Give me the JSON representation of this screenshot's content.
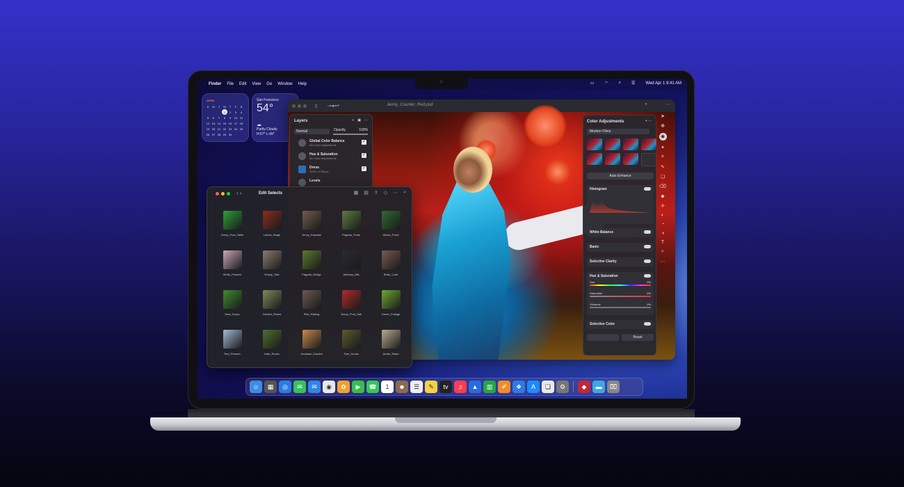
{
  "menubar": {
    "apple": "",
    "app": "Finder",
    "items": [
      "File",
      "Edit",
      "View",
      "Go",
      "Window",
      "Help"
    ],
    "datetime": "Wed Apr 1  9:41 AM"
  },
  "calendar": {
    "month": "APRIL",
    "weekdays": [
      "S",
      "M",
      "T",
      "W",
      "T",
      "F",
      "S"
    ],
    "weeks": [
      [
        "",
        "",
        "",
        "1",
        "2",
        "3",
        "4"
      ],
      [
        "5",
        "6",
        "7",
        "8",
        "9",
        "10",
        "11"
      ],
      [
        "12",
        "13",
        "14",
        "15",
        "16",
        "17",
        "18"
      ],
      [
        "19",
        "20",
        "21",
        "22",
        "23",
        "24",
        "25"
      ],
      [
        "26",
        "27",
        "28",
        "29",
        "30",
        "",
        ""
      ]
    ],
    "today": "1"
  },
  "weather": {
    "city": "San Francisco",
    "temp": "54°",
    "condition": "Partly Cloudy",
    "hilo": "H:57° L:49°"
  },
  "photo_app": {
    "filename": "Jenny_Counter_Red.psd"
  },
  "layers": {
    "title": "Layers",
    "blend_mode": "Normal",
    "opacity_label": "Opacity",
    "opacity_value": "100%",
    "items": [
      {
        "name": "Global Color Balance",
        "sub": "No Color Adjustments"
      },
      {
        "name": "Hue & Saturation",
        "sub": "No Color Adjustments"
      },
      {
        "name": "Dress",
        "sub": "1203 x 1755 px"
      },
      {
        "name": "Levels",
        "sub": ""
      }
    ]
  },
  "color_adjustments": {
    "title": "Color Adjustments",
    "preset": "Modern Films",
    "auto": "Auto Enhance",
    "histogram": "Histogram",
    "white_balance": "White Balance",
    "basic": "Basic",
    "selective_clarity": "Selective Clarity",
    "hue_sat": "Hue & Saturation",
    "hue": "Hue",
    "saturation": "Saturation",
    "vibrance": "Vibrance",
    "zero": "0%",
    "selective_color": "Selective Color",
    "reset": "Reset"
  },
  "finder": {
    "title": "Edit Selects",
    "items": [
      {
        "name": "Jenny_Pool_Table",
        "color": "#2f9e3a"
      },
      {
        "name": "Leticia_Stage",
        "color": "#8b2d1d"
      },
      {
        "name": "Jenny_Karaoke",
        "color": "#6f5d4a"
      },
      {
        "name": "Pagoda_Trees",
        "color": "#5c7b42"
      },
      {
        "name": "Aileen_Pond",
        "color": "#2e6b32"
      },
      {
        "name": "White_Flowers",
        "color": "#c9a6b7"
      },
      {
        "name": "Empty_Tabi",
        "color": "#8a7b70"
      },
      {
        "name": "Pagoda_Bridge",
        "color": "#5b7a2e"
      },
      {
        "name": "Anthony_Mis",
        "color": "#2b2b36"
      },
      {
        "name": "Brian_Look",
        "color": "#7a5a4e"
      },
      {
        "name": "Dew_Drops",
        "color": "#3f8a2f"
      },
      {
        "name": "Garden_Rocks",
        "color": "#7a8a5a"
      },
      {
        "name": "Rich_Railing",
        "color": "#6a5a52"
      },
      {
        "name": "Jenny_Pool_Hall",
        "color": "#b22a2a"
      },
      {
        "name": "Green_Foliage",
        "color": "#6fa634"
      },
      {
        "name": "Red_Flowers",
        "color": "#9fb8d8"
      },
      {
        "name": "Kate_Rocks",
        "color": "#4f6e2e"
      },
      {
        "name": "Jonathan_Garden",
        "color": "#c58a4a"
      },
      {
        "name": "Tree_House",
        "color": "#5a5a30"
      },
      {
        "name": "Andre_Stairs",
        "color": "#b8a890"
      }
    ]
  },
  "dock": [
    "finder-icon",
    "launchpad-icon",
    "safari-icon",
    "messages-icon",
    "mail-icon",
    "maps-icon",
    "photos-icon",
    "facetime-icon",
    "phone-icon",
    "calendar-icon",
    "contacts-icon",
    "reminders-icon",
    "notes-icon",
    "tv-icon",
    "music-icon",
    "keynote-icon",
    "numbers-icon",
    "pages-icon",
    "instruments-icon",
    "app-store-icon",
    "files-icon",
    "settings-icon",
    "photomator-icon",
    "folder-icon",
    "trash-icon"
  ]
}
